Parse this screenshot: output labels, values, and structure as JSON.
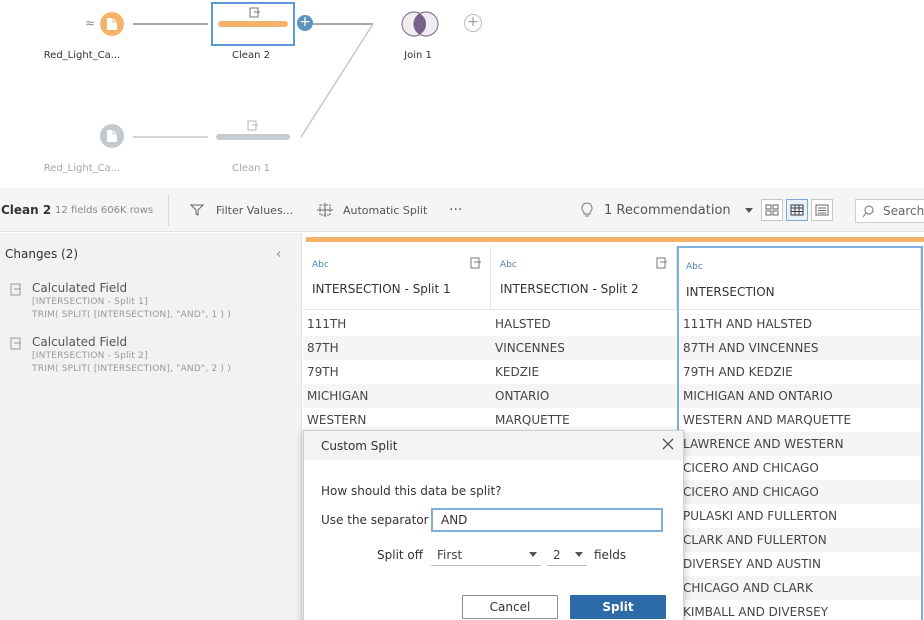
{
  "flow": {
    "input_top": "Red_Light_Ca...",
    "input_bottom": "Red_Light_Ca...",
    "clean2": "Clean 2",
    "clean1": "Clean 1",
    "join": "Join 1"
  },
  "toolbar": {
    "step_name": "Clean 2",
    "meta": "12 fields  606K rows",
    "filter": "Filter Values...",
    "auto_split": "Automatic Split",
    "more": "···",
    "recommendation": "1 Recommendation",
    "search": "Search"
  },
  "changes": {
    "title": "Changes (2)",
    "items": [
      {
        "name": "Calculated Field",
        "field": "[INTERSECTION - Split 1]",
        "formula": "TRIM( SPLIT( [INTERSECTION], \"AND\", 1 ) )"
      },
      {
        "name": "Calculated Field",
        "field": "[INTERSECTION - Split 2]",
        "formula": "TRIM( SPLIT( [INTERSECTION], \"AND\", 2 ) )"
      }
    ]
  },
  "grid": {
    "columns": [
      {
        "type": "Abc",
        "name": "INTERSECTION - Split 1"
      },
      {
        "type": "Abc",
        "name": "INTERSECTION - Split 2"
      },
      {
        "type": "Abc",
        "name": "INTERSECTION"
      }
    ],
    "rows": [
      [
        "111TH",
        "HALSTED",
        "111TH AND HALSTED"
      ],
      [
        "87TH",
        "VINCENNES",
        "87TH AND VINCENNES"
      ],
      [
        "79TH",
        "KEDZIE",
        "79TH AND KEDZIE"
      ],
      [
        "MICHIGAN",
        "ONTARIO",
        "MICHIGAN AND ONTARIO"
      ],
      [
        "WESTERN",
        "MARQUETTE",
        "WESTERN AND MARQUETTE"
      ],
      [
        "",
        "",
        "LAWRENCE AND WESTERN"
      ],
      [
        "",
        "",
        "CICERO AND CHICAGO"
      ],
      [
        "",
        "",
        "CICERO AND CHICAGO"
      ],
      [
        "",
        "",
        "PULASKI AND FULLERTON"
      ],
      [
        "",
        "",
        "CLARK AND FULLERTON"
      ],
      [
        "",
        "",
        "DIVERSEY AND AUSTIN"
      ],
      [
        "",
        "",
        "CHICAGO AND CLARK"
      ],
      [
        "",
        "",
        "KIMBALL AND DIVERSEY"
      ]
    ]
  },
  "dialog": {
    "title": "Custom Split",
    "question": "How should this data be split?",
    "separator_label": "Use the separator",
    "separator_value": "AND",
    "split_off_label": "Split off",
    "split_off_value": "First",
    "count_value": "2",
    "fields_label": "fields",
    "cancel": "Cancel",
    "split": "Split"
  },
  "colors": {
    "accent_orange": "#f4b36b",
    "accent_blue": "#2c6aa8",
    "selection_blue": "#7fb0dd"
  }
}
